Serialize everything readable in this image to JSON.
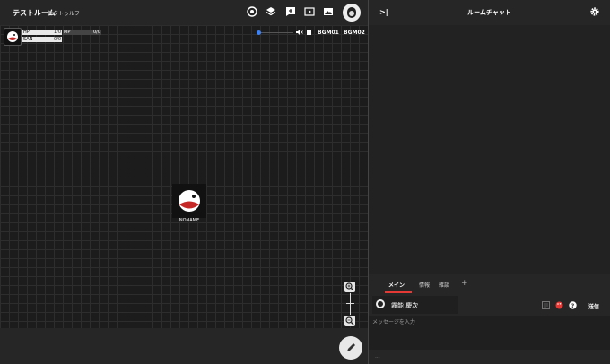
{
  "room": {
    "title": "テストルーム",
    "subtitle": "新クトゥルフ"
  },
  "toolbar_icons": [
    "dice-icon",
    "layers-icon",
    "add-comment-icon",
    "video-icon",
    "image-icon",
    "user-avatar"
  ],
  "stats": {
    "hp": {
      "label": "HP",
      "value": "1/0"
    },
    "mp": {
      "label": "MP",
      "value": "0/0"
    },
    "san": {
      "label": "SAN",
      "value": "0/0"
    }
  },
  "audio": {
    "bgm1": "BGM01",
    "bgm2": "BGM02",
    "volume": 0.05
  },
  "token": {
    "name": "NONAME"
  },
  "chat": {
    "collapse": ">|",
    "title": "ルームチャット",
    "tabs": [
      "メイン",
      "情報",
      "雑談"
    ],
    "add_tab": "+",
    "speaker": "霧能 慶次",
    "send": "送信",
    "placeholder": "メッセージを入力",
    "footer": "..."
  },
  "colors": {
    "accent": "#e53935",
    "background": "#262626",
    "board": "#1c1c1c",
    "slider": "#3b82f6"
  }
}
